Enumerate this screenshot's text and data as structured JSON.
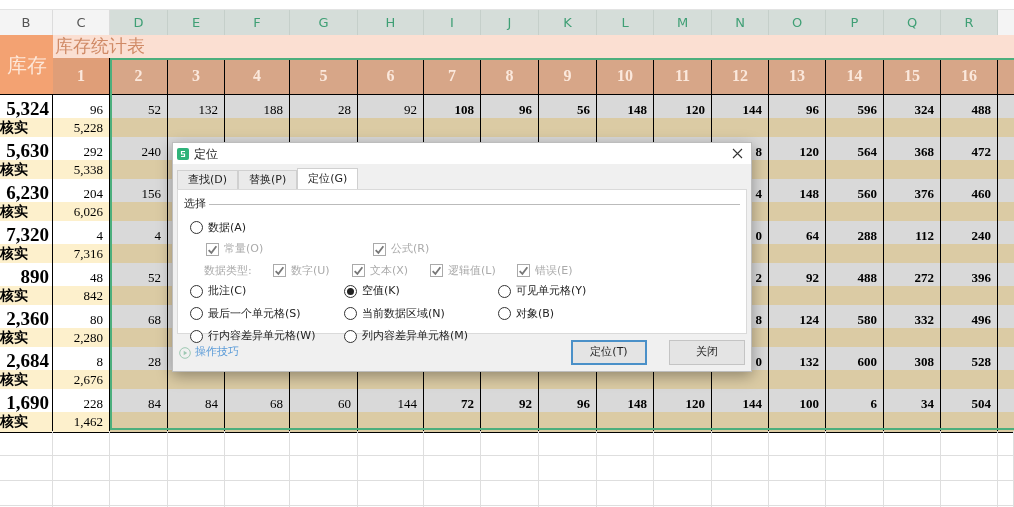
{
  "column_headers": [
    {
      "label": "B",
      "selected": false
    },
    {
      "label": "C",
      "selected": false
    },
    {
      "label": "D",
      "selected": true
    },
    {
      "label": "E",
      "selected": true
    },
    {
      "label": "F",
      "selected": true
    },
    {
      "label": "G",
      "selected": true
    },
    {
      "label": "H",
      "selected": true
    },
    {
      "label": "I",
      "selected": true
    },
    {
      "label": "J",
      "selected": true
    },
    {
      "label": "K",
      "selected": true
    },
    {
      "label": "L",
      "selected": true
    },
    {
      "label": "M",
      "selected": true
    },
    {
      "label": "N",
      "selected": true
    },
    {
      "label": "O",
      "selected": true
    },
    {
      "label": "P",
      "selected": true
    },
    {
      "label": "Q",
      "selected": true
    },
    {
      "label": "R",
      "selected": true
    }
  ],
  "corner_label": "库存",
  "title": "库存统计表",
  "day_headers": [
    "1",
    "2",
    "3",
    "4",
    "5",
    "6",
    "7",
    "8",
    "9",
    "10",
    "11",
    "12",
    "13",
    "14",
    "15",
    "16"
  ],
  "rows": [
    {
      "kind": "total",
      "label": "5,324",
      "cells": [
        "96",
        "52",
        "132",
        "188",
        "28",
        "92",
        "108",
        "96",
        "56",
        "148",
        "120",
        "144",
        "96",
        "596",
        "324",
        "488"
      ]
    },
    {
      "kind": "check",
      "label": "核实",
      "cells": [
        "5,228"
      ]
    },
    {
      "kind": "total",
      "label": "5,630",
      "cells": [
        "292",
        "240",
        null,
        null,
        null,
        null,
        null,
        null,
        null,
        null,
        null,
        "8",
        "120",
        "564",
        "368",
        "472"
      ]
    },
    {
      "kind": "check",
      "label": "核实",
      "cells": [
        "5,338"
      ]
    },
    {
      "kind": "total",
      "label": "6,230",
      "cells": [
        "204",
        "156",
        null,
        null,
        null,
        null,
        null,
        null,
        null,
        null,
        null,
        "4",
        "148",
        "560",
        "376",
        "460"
      ]
    },
    {
      "kind": "check",
      "label": "核实",
      "cells": [
        "6,026"
      ]
    },
    {
      "kind": "total",
      "label": "7,320",
      "cells": [
        "4",
        "4",
        null,
        null,
        null,
        null,
        null,
        null,
        null,
        null,
        null,
        "0",
        "64",
        "288",
        "112",
        "240"
      ]
    },
    {
      "kind": "check",
      "label": "核实",
      "cells": [
        "7,316"
      ]
    },
    {
      "kind": "total",
      "label": "890",
      "cells": [
        "48",
        "52",
        null,
        null,
        null,
        null,
        null,
        null,
        null,
        null,
        null,
        "2",
        "92",
        "488",
        "272",
        "396"
      ]
    },
    {
      "kind": "check",
      "label": "核实",
      "cells": [
        "842"
      ]
    },
    {
      "kind": "total",
      "label": "2,360",
      "cells": [
        "80",
        "68",
        null,
        null,
        null,
        null,
        null,
        null,
        null,
        null,
        null,
        "8",
        "124",
        "580",
        "332",
        "496"
      ]
    },
    {
      "kind": "check",
      "label": "核实",
      "cells": [
        "2,280"
      ]
    },
    {
      "kind": "total",
      "label": "2,684",
      "cells": [
        "8",
        "28",
        null,
        null,
        null,
        null,
        null,
        null,
        null,
        null,
        null,
        "0",
        "132",
        "600",
        "308",
        "528"
      ]
    },
    {
      "kind": "check",
      "label": "核实",
      "cells": [
        "2,676"
      ]
    },
    {
      "kind": "total",
      "label": "1,690",
      "cells": [
        "228",
        "84",
        "84",
        "68",
        "60",
        "144",
        "72",
        "92",
        "96",
        "148",
        "120",
        "144",
        "100",
        "6",
        "34",
        "504"
      ]
    },
    {
      "kind": "check",
      "label": "核实",
      "cells": [
        "1,462"
      ]
    }
  ],
  "dialog": {
    "title": "定位",
    "tabs": [
      {
        "label": "查找(D)",
        "selected": false
      },
      {
        "label": "替换(P)",
        "selected": false
      },
      {
        "label": "定位(G)",
        "selected": true
      }
    ],
    "group_label": "选择",
    "data_option": {
      "label": "数据(A)",
      "selected": false
    },
    "data_subtypes": [
      {
        "label": "常量(O)",
        "checked": true,
        "disabled": true
      },
      {
        "label": "公式(R)",
        "checked": true,
        "disabled": true
      }
    ],
    "data_types_label": "数据类型:",
    "data_types": [
      {
        "label": "数字(U)",
        "checked": true,
        "disabled": true
      },
      {
        "label": "文本(X)",
        "checked": true,
        "disabled": true
      },
      {
        "label": "逻辑值(L)",
        "checked": true,
        "disabled": true
      },
      {
        "label": "错误(E)",
        "checked": true,
        "disabled": true
      }
    ],
    "options": [
      {
        "label": "批注(C)",
        "selected": false
      },
      {
        "label": "空值(K)",
        "selected": true
      },
      {
        "label": "可见单元格(Y)",
        "selected": false
      },
      {
        "label": "最后一个单元格(S)",
        "selected": false
      },
      {
        "label": "当前数据区域(N)",
        "selected": false
      },
      {
        "label": "对象(B)",
        "selected": false
      },
      {
        "label": "行内容差异单元格(W)",
        "selected": false
      },
      {
        "label": "列内容差异单元格(M)",
        "selected": false
      }
    ],
    "tips_link": "操作技巧",
    "buttons": [
      {
        "label": "定位(T)",
        "default": true
      },
      {
        "label": "关闭",
        "default": false
      }
    ]
  }
}
